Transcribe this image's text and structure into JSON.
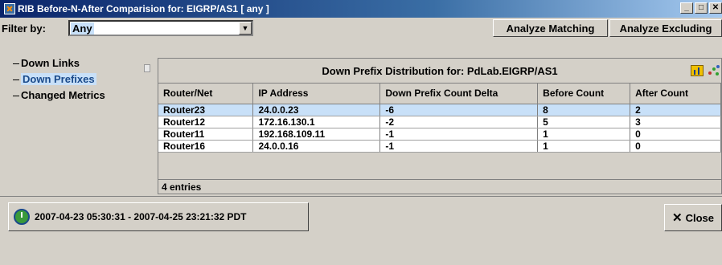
{
  "window": {
    "title": "RIB Before-N-After Comparision for: EIGRP/AS1 [ any ]"
  },
  "filter": {
    "label": "Filter by:",
    "value": "Any"
  },
  "buttons": {
    "analyze_matching": "Analyze Matching",
    "analyze_excluding": "Analyze Excluding",
    "close": "Close"
  },
  "tree": {
    "items": [
      "Down Links",
      "Down Prefixes",
      "Changed Metrics"
    ],
    "selected": 1
  },
  "panel": {
    "title": "Down Prefix Distribution for: PdLab.EIGRP/AS1"
  },
  "table": {
    "columns": [
      "Router/Net",
      "IP Address",
      "Down Prefix Count Delta",
      "Before Count",
      "After Count"
    ],
    "rows": [
      [
        "Router23",
        "24.0.0.23",
        "-6",
        "8",
        "2"
      ],
      [
        "Router12",
        "172.16.130.1",
        "-2",
        "5",
        "3"
      ],
      [
        "Router11",
        "192.168.109.11",
        "-1",
        "1",
        "0"
      ],
      [
        "Router16",
        "24.0.0.16",
        "-1",
        "1",
        "0"
      ]
    ],
    "selected_row": 0
  },
  "entries_label": "4 entries",
  "time_range": "2007-04-23 05:30:31 - 2007-04-25 23:21:32 PDT"
}
